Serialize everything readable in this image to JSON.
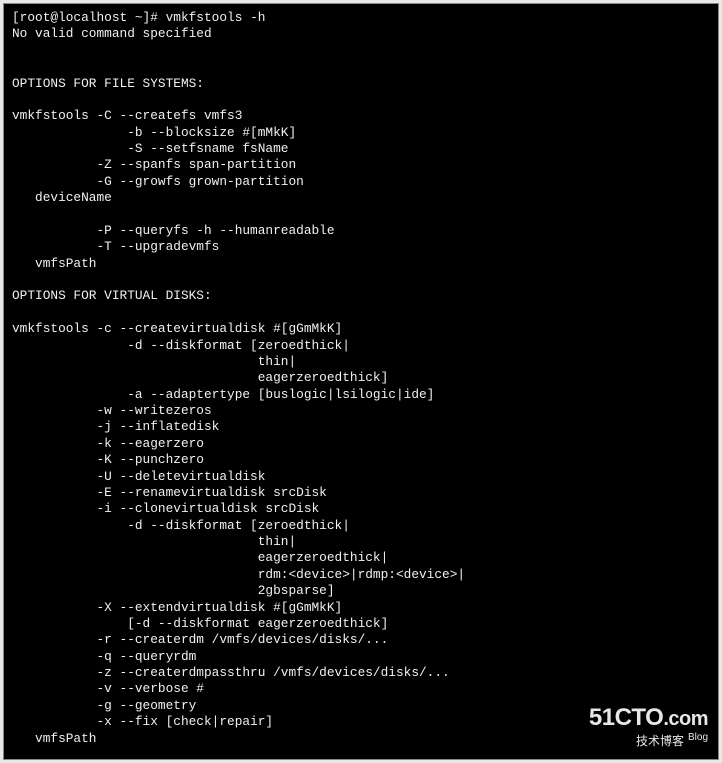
{
  "terminal": {
    "prompt": "[root@localhost ~]# ",
    "command": "vmkfstools -h",
    "output_lines": [
      "No valid command specified",
      "",
      "",
      "OPTIONS FOR FILE SYSTEMS:",
      "",
      "vmkfstools -C --createfs vmfs3",
      "               -b --blocksize #[mMkK]",
      "               -S --setfsname fsName",
      "           -Z --spanfs span-partition",
      "           -G --growfs grown-partition",
      "   deviceName",
      "",
      "           -P --queryfs -h --humanreadable",
      "           -T --upgradevmfs",
      "   vmfsPath",
      "",
      "OPTIONS FOR VIRTUAL DISKS:",
      "",
      "vmkfstools -c --createvirtualdisk #[gGmMkK]",
      "               -d --diskformat [zeroedthick|",
      "                                thin|",
      "                                eagerzeroedthick]",
      "               -a --adaptertype [buslogic|lsilogic|ide]",
      "           -w --writezeros",
      "           -j --inflatedisk",
      "           -k --eagerzero",
      "           -K --punchzero",
      "           -U --deletevirtualdisk",
      "           -E --renamevirtualdisk srcDisk",
      "           -i --clonevirtualdisk srcDisk",
      "               -d --diskformat [zeroedthick|",
      "                                thin|",
      "                                eagerzeroedthick|",
      "                                rdm:<device>|rdmp:<device>|",
      "                                2gbsparse]",
      "           -X --extendvirtualdisk #[gGmMkK]",
      "               [-d --diskformat eagerzeroedthick]",
      "           -r --createrdm /vmfs/devices/disks/...",
      "           -q --queryrdm",
      "           -z --createrdmpassthru /vmfs/devices/disks/...",
      "           -v --verbose #",
      "           -g --geometry",
      "           -x --fix [check|repair]",
      "   vmfsPath"
    ]
  },
  "watermark": {
    "brand_main": "51CTO",
    "brand_suffix": ".com",
    "subtitle": "技术博客",
    "blog_tag": "Blog"
  }
}
